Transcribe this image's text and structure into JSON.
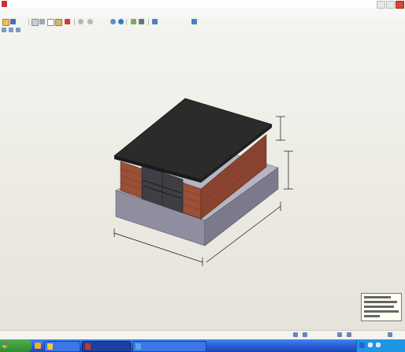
{
  "window": {
    "title": "",
    "search_hint": "",
    "colors": {
      "title_text": "#3a4a7a",
      "chrome": "#f7f7f5",
      "close": "#d7463a"
    }
  },
  "menu": {
    "items": [
      {
        "label": ""
      },
      {
        "label": ""
      },
      {
        "label": ""
      },
      {
        "label": ""
      }
    ]
  },
  "toolbar": {
    "zoom": "",
    "icons": [
      "open-file-icon",
      "save-icon",
      "print-icon",
      "cut-icon",
      "copy-icon",
      "paste-icon",
      "delete-icon",
      "undo-icon",
      "redo-icon",
      "zoom-icon",
      "globe-icon",
      "walkthrough-icon",
      "camera-icon"
    ]
  },
  "model": {
    "dimensions": {
      "width_label": "",
      "depth_label": "",
      "height_label": "",
      "foundation_height_label": "",
      "door_width_label": "",
      "door_height_label": ""
    },
    "colors": {
      "roof": "#2b2b2b",
      "brick": "#9a4f36",
      "foundation": "#8f8ea0",
      "door": "#3d3f44"
    }
  },
  "status": {
    "left": ""
  },
  "taskbar": {
    "start_label": "",
    "tasks": [
      {
        "label": ""
      },
      {
        "label": ""
      },
      {
        "label": ""
      }
    ],
    "clock": "",
    "colors": {
      "bar": "#2458d3",
      "start": "#318a2e",
      "tray": "#1e95e5"
    }
  }
}
